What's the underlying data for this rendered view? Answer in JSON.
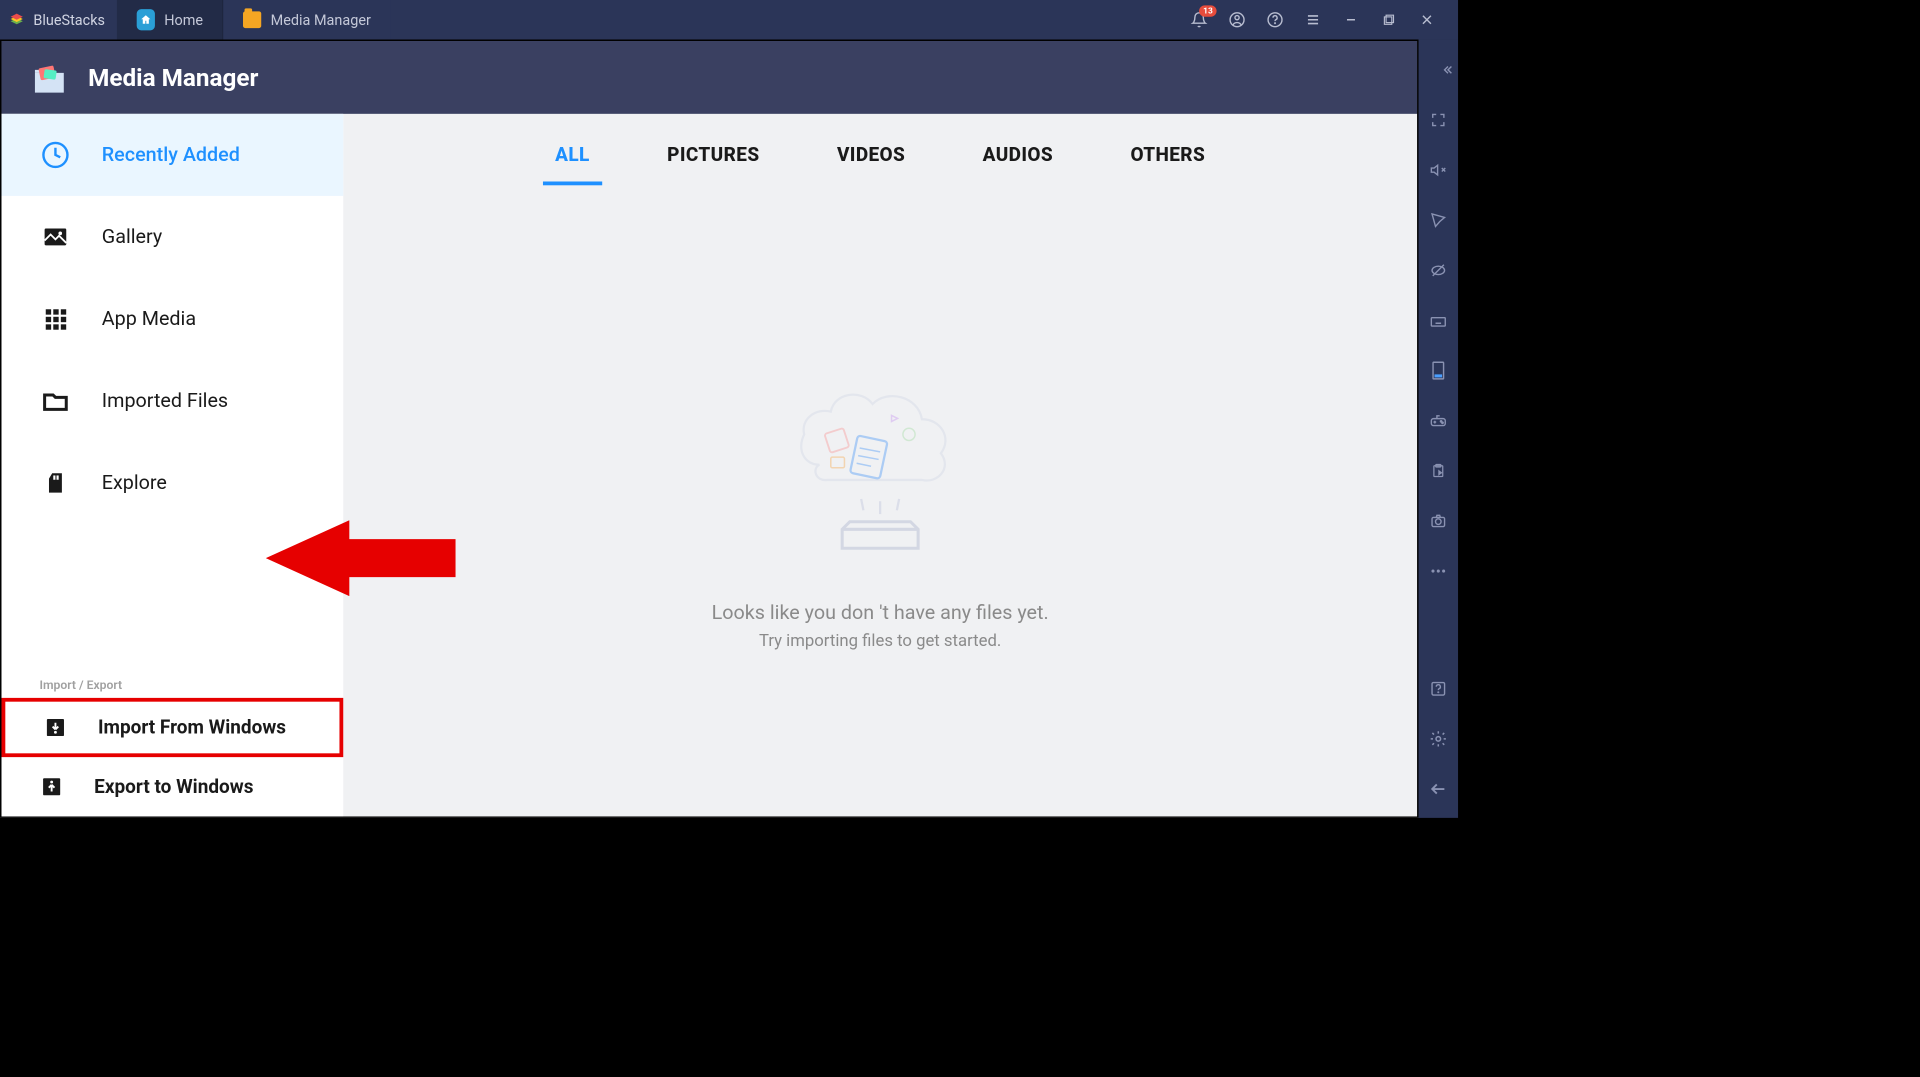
{
  "titlebar": {
    "brand": "BlueStacks",
    "tabs": [
      {
        "label": "Home",
        "icon": "home"
      },
      {
        "label": "Media Manager",
        "icon": "folder"
      }
    ],
    "notification_count": "13"
  },
  "app_header": {
    "title": "Media Manager"
  },
  "sidebar": {
    "items": [
      {
        "id": "recent",
        "label": "Recently Added",
        "active": true
      },
      {
        "id": "gallery",
        "label": "Gallery"
      },
      {
        "id": "appmedia",
        "label": "App Media"
      },
      {
        "id": "imported",
        "label": "Imported Files"
      },
      {
        "id": "explore",
        "label": "Explore"
      }
    ],
    "section_label": "Import / Export",
    "io_items": [
      {
        "id": "import",
        "label": "Import From Windows",
        "highlighted": true
      },
      {
        "id": "export",
        "label": "Export to Windows"
      }
    ]
  },
  "content": {
    "tabs": [
      {
        "id": "all",
        "label": "ALL",
        "active": true
      },
      {
        "id": "pictures",
        "label": "PICTURES"
      },
      {
        "id": "videos",
        "label": "VIDEOS"
      },
      {
        "id": "audios",
        "label": "AUDIOS"
      },
      {
        "id": "others",
        "label": "OTHERS"
      }
    ],
    "empty": {
      "line1": "Looks like you don 't have any files yet.",
      "line2": "Try importing files to get started."
    }
  }
}
